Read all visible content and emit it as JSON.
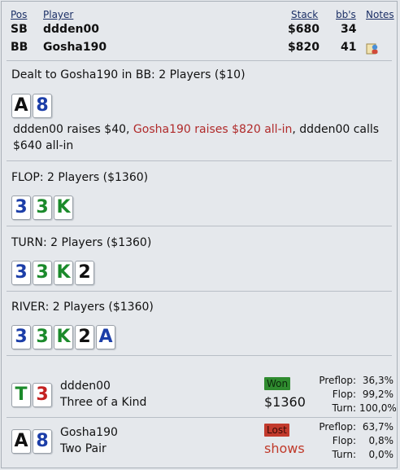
{
  "header": {
    "pos": "Pos",
    "player": "Player",
    "stack": "Stack",
    "bbs": "bb's",
    "notes": "Notes"
  },
  "players": [
    {
      "pos": "SB",
      "name": "ddden00",
      "stack": "$680",
      "bbs": "34"
    },
    {
      "pos": "BB",
      "name": "Gosha190",
      "stack": "$820",
      "bbs": "41"
    }
  ],
  "preflop": {
    "title": "Dealt to Gosha190 in BB: 2 Players ($10)",
    "hole_cards": [
      {
        "rank": "A",
        "suit": "black"
      },
      {
        "rank": "8",
        "suit": "blue"
      }
    ],
    "action_a": "ddden00 raises $40, ",
    "action_b": "Gosha190 raises $820 all-in",
    "action_c": ", ddden00 calls $640 all-in"
  },
  "flop": {
    "title": "FLOP: 2 Players ($1360)",
    "cards": [
      {
        "rank": "3",
        "suit": "blue"
      },
      {
        "rank": "3",
        "suit": "green"
      },
      {
        "rank": "K",
        "suit": "green"
      }
    ]
  },
  "turn": {
    "title": "TURN: 2 Players ($1360)",
    "cards": [
      {
        "rank": "3",
        "suit": "blue"
      },
      {
        "rank": "3",
        "suit": "green"
      },
      {
        "rank": "K",
        "suit": "green"
      },
      {
        "rank": "2",
        "suit": "black"
      }
    ]
  },
  "river": {
    "title": "RIVER: 2 Players ($1360)",
    "cards": [
      {
        "rank": "3",
        "suit": "blue"
      },
      {
        "rank": "3",
        "suit": "green"
      },
      {
        "rank": "K",
        "suit": "green"
      },
      {
        "rank": "2",
        "suit": "black"
      },
      {
        "rank": "A",
        "suit": "blue"
      }
    ]
  },
  "results": [
    {
      "cards": [
        {
          "rank": "T",
          "suit": "green"
        },
        {
          "rank": "3",
          "suit": "red"
        }
      ],
      "name": "ddden00",
      "hand": "Three of a Kind",
      "badge": "Won",
      "amount": "$1360",
      "stats": {
        "preflop_label": "Preflop:",
        "preflop": "36,3%",
        "flop_label": "Flop:",
        "flop": "99,2%",
        "turn_label": "Turn:",
        "turn": "100,0%"
      }
    },
    {
      "cards": [
        {
          "rank": "A",
          "suit": "black"
        },
        {
          "rank": "8",
          "suit": "blue"
        }
      ],
      "name": "Gosha190",
      "hand": "Two Pair",
      "badge": "Lost",
      "amount": "shows",
      "stats": {
        "preflop_label": "Preflop:",
        "preflop": "63,7%",
        "flop_label": "Flop:",
        "flop": "0,8%",
        "turn_label": "Turn:",
        "turn": "0,0%"
      }
    }
  ],
  "colors": {
    "black": "#111111",
    "blue": "#1c3ea8",
    "green": "#1b8a2b",
    "red": "#c42222"
  }
}
